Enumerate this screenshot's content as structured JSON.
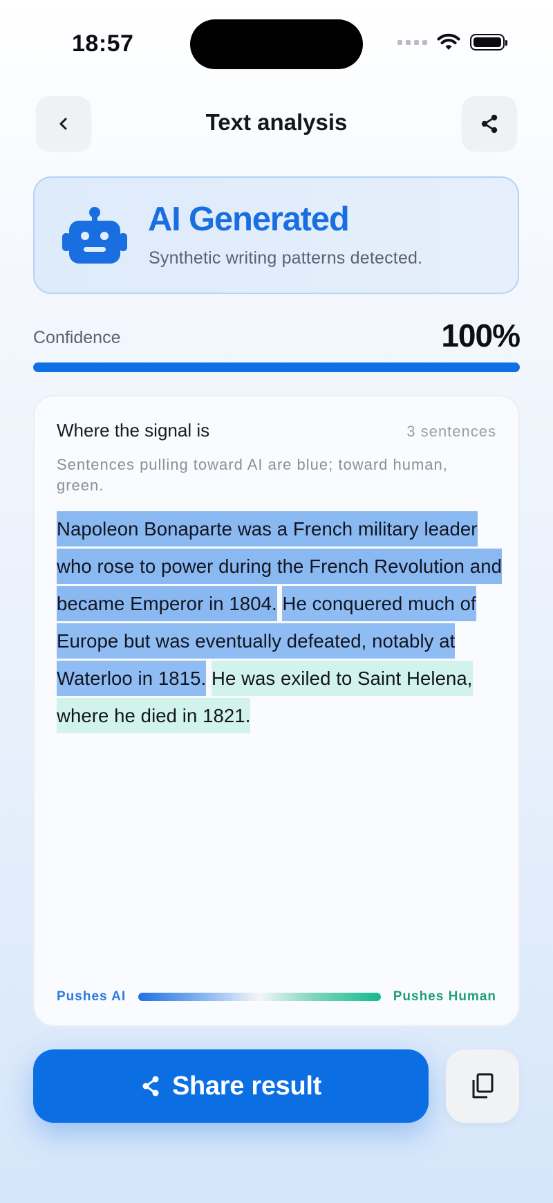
{
  "status_bar": {
    "time": "18:57"
  },
  "header": {
    "title": "Text analysis",
    "back_icon": "chevron-left-icon",
    "share_icon": "share-icon"
  },
  "verdict": {
    "title": "AI Generated",
    "subtitle": "Synthetic writing patterns detected.",
    "icon": "robot-icon",
    "accent_color": "#1a6fe0"
  },
  "confidence": {
    "label": "Confidence",
    "value_text": "100%",
    "value": 1.0,
    "bar_color": "#0f6fe4"
  },
  "signal": {
    "title": "Where the signal is",
    "count": "3 sentences",
    "description": "Sentences pulling toward AI are blue; toward human, green.",
    "sentences": [
      {
        "text": "Napoleon Bonaparte was a French military leader who rose to power during the French Revolution and became Emperor in 1804.",
        "lean": "ai"
      },
      {
        "text": "He conquered much of Europe but was eventually defeated, notably at Waterloo in 1815.",
        "lean": "ai"
      },
      {
        "text": "He was exiled to Saint Helena, where he died in 1821.",
        "lean": "human"
      }
    ],
    "legend": {
      "left": "Pushes AI",
      "right": "Pushes Human",
      "ai_color": "#2d79dd",
      "human_color": "#1e9f74"
    }
  },
  "actions": {
    "share_label": "Share result",
    "share_icon": "share-icon",
    "copy_icon": "copy-icon",
    "primary_color": "#0b6fe3"
  }
}
